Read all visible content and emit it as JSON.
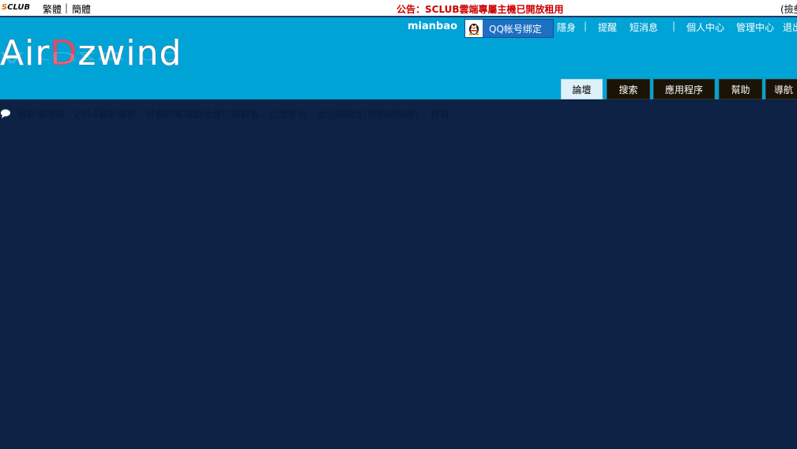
{
  "topbar": {
    "logo_s": "S",
    "logo_rest": "CLUB",
    "lang_traditional": "繁體",
    "lang_separator": "|",
    "lang_simplified": "簡體",
    "announcement": "公告：SCLUB雲端專屬主機已開放租用",
    "right_cut": "(撿些"
  },
  "header": {
    "logo_part1": "Air",
    "logo_part2": "D",
    "logo_part3": "zwind",
    "username": "mianbao",
    "qq_label": "QQ帐号绑定",
    "links": [
      "隱身",
      "|",
      "提醒",
      "短消息",
      "|",
      "個人中心",
      "管理中心",
      "退出"
    ]
  },
  "nav": {
    "tabs": [
      "論壇",
      "搜索",
      "應用程序",
      "幫助",
      "導航"
    ],
    "active": "論壇"
  },
  "breadcrumb": {
    "text": "最新電視劇，2014最新電影，好看的電視劇免費在線觀看，百度影音 - 面包網論壇(奇熱網論壇) » 首頁"
  },
  "colors": {
    "page_bg": "#0d2245",
    "header_bg": "#00a3d5",
    "announcement": "#cc0000",
    "tab_bg": "#1a1306",
    "tab_active_bg": "#dff1f8"
  }
}
